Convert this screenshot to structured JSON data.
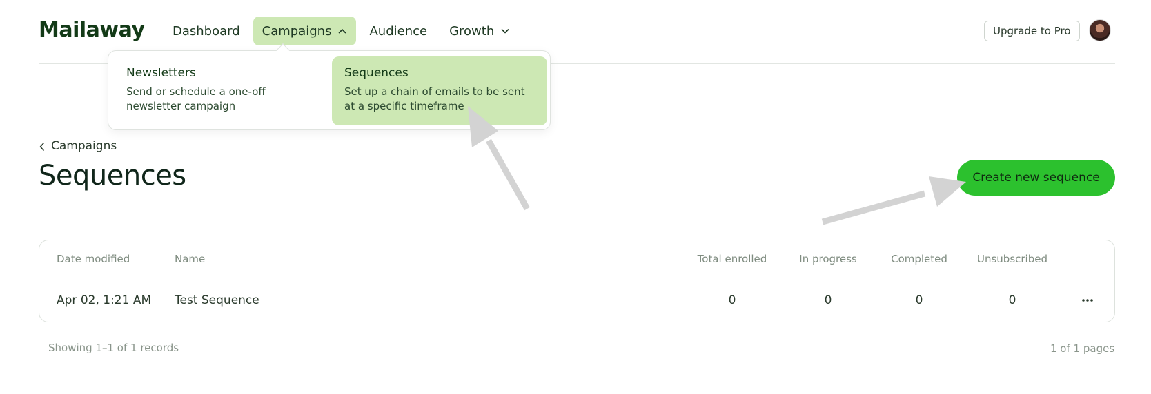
{
  "app": {
    "logo": "Mailaway"
  },
  "nav": {
    "items": [
      {
        "label": "Dashboard"
      },
      {
        "label": "Campaigns",
        "active": true,
        "icon": "chevron-up-icon"
      },
      {
        "label": "Audience"
      },
      {
        "label": "Growth",
        "icon": "chevron-down-icon"
      }
    ]
  },
  "header": {
    "upgrade_label": "Upgrade to Pro",
    "avatar": "user-avatar"
  },
  "dropdown": {
    "items": [
      {
        "title": "Newsletters",
        "description": "Send or schedule a one-off newsletter campaign"
      },
      {
        "title": "Sequences",
        "description": "Set up a chain of emails to be sent at a specific timeframe",
        "highlighted": true
      }
    ]
  },
  "page": {
    "breadcrumb": "Campaigns",
    "title": "Sequences",
    "create_label": "Create new sequence"
  },
  "table": {
    "columns": [
      "Date modified",
      "Name",
      "Total enrolled",
      "In progress",
      "Completed",
      "Unsubscribed"
    ],
    "rows": [
      {
        "date": "Apr 02, 1:21 AM",
        "name": "Test Sequence",
        "total": "0",
        "in_progress": "0",
        "completed": "0",
        "unsubscribed": "0",
        "menu": "more-icon"
      }
    ]
  },
  "footer": {
    "records": "Showing 1–1 of 1 records",
    "pages": "1 of 1 pages"
  },
  "colors": {
    "accent_green": "#2cc12e",
    "highlight_green": "#cde8b4",
    "text_dark": "#133a17",
    "annotation_arrow": "#d3d3d3"
  }
}
